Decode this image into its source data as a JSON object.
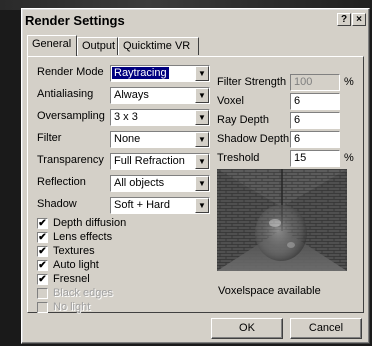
{
  "dialog": {
    "title": "Render Settings",
    "help_glyph": "?",
    "close_glyph": "×"
  },
  "tabs": [
    {
      "label": "General"
    },
    {
      "label": "Output"
    },
    {
      "label": "Quicktime VR"
    }
  ],
  "left": {
    "render_mode": {
      "label": "Render Mode",
      "value": "Raytracing"
    },
    "antialiasing": {
      "label": "Antialiasing",
      "value": "Always"
    },
    "oversampling": {
      "label": "Oversampling",
      "value": "3 x 3"
    },
    "filter": {
      "label": "Filter",
      "value": "None"
    },
    "transparency": {
      "label": "Transparency",
      "value": "Full Refraction"
    },
    "reflection": {
      "label": "Reflection",
      "value": "All objects"
    },
    "shadow": {
      "label": "Shadow",
      "value": "Soft + Hard"
    }
  },
  "checkboxes": [
    {
      "label": "Depth diffusion",
      "checked": true,
      "enabled": true
    },
    {
      "label": "Lens effects",
      "checked": true,
      "enabled": true
    },
    {
      "label": "Textures",
      "checked": true,
      "enabled": true
    },
    {
      "label": "Auto light",
      "checked": true,
      "enabled": true
    },
    {
      "label": "Fresnel",
      "checked": true,
      "enabled": true
    },
    {
      "label": "Black edges",
      "checked": false,
      "enabled": false
    },
    {
      "label": "No light",
      "checked": false,
      "enabled": false
    }
  ],
  "check_glyph": "✔",
  "right": {
    "filter_strength": {
      "label": "Filter Strength",
      "value": "100",
      "unit": "%"
    },
    "voxel": {
      "label": "Voxel",
      "value": "6"
    },
    "ray_depth": {
      "label": "Ray Depth",
      "value": "6"
    },
    "shadow_depth": {
      "label": "Shadow Depth",
      "value": "6"
    },
    "treshold": {
      "label": "Treshold",
      "value": "15",
      "unit": "%"
    }
  },
  "status": "Voxelspace available",
  "buttons": {
    "ok": "OK",
    "cancel": "Cancel"
  },
  "icons": {
    "dropdown": "triangle-down-icon"
  }
}
